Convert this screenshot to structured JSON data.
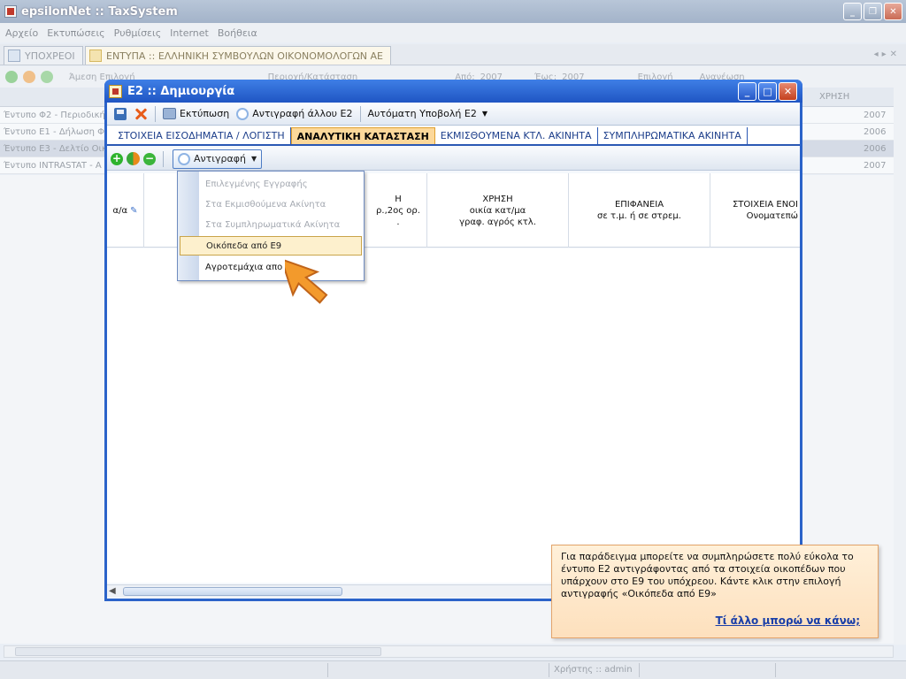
{
  "app": {
    "title": "epsilonNet :: TaxSystem",
    "window_controls": [
      "_",
      "❐",
      "✕"
    ]
  },
  "menu": [
    "Αρχείο",
    "Εκτυπώσεις",
    "Ρυθμίσεις",
    "Internet",
    "Βοήθεια"
  ],
  "doc_tabs": [
    {
      "label": "ΥΠΟΧΡΕΟΙ"
    },
    {
      "label": "ΕΝΤΥΠΑ :: ΕΛΛΗΝΙΚΗ ΣΥΜΒΟΥΛΩΝ ΟΙΚΟΝΟΜΟΛΟΓΩΝ ΑΕ"
    }
  ],
  "main_toolbar": {
    "filter": "Άμεση Επιλογή",
    "period": "Περιοχή/Κατάσταση",
    "from_label": "Από:",
    "from_year": "2007",
    "to_label": "Έως:",
    "to_year": "2007",
    "select": "Επιλογή",
    "refresh": "Ανανέωση"
  },
  "grid": {
    "col_year": "ΧΡΗΣΗ",
    "rows": [
      {
        "text": "Έντυπο Φ2 - Περιοδική",
        "year": "2007",
        "selected": false
      },
      {
        "text": "Έντυπο Ε1 - Δήλωση Φ",
        "year": "2006",
        "selected": false
      },
      {
        "text": "Έντυπο Ε3 - Δελτίο Οικ",
        "year": "2006",
        "selected": true
      },
      {
        "text": "Έντυπο INTRASTAT - Α",
        "year": "2007",
        "selected": false
      }
    ]
  },
  "status": {
    "user": "Χρήστης :: admin"
  },
  "dialog": {
    "title": "Ε2 :: Δημιουργία",
    "toolbar": {
      "print": "Εκτύπωση",
      "copy_other": "Αντιγραφή άλλου Ε2",
      "auto_submit": "Αυτόματη Υποβολή Ε2"
    },
    "tabs": [
      {
        "label": "ΣΤΟΙΧΕΙΑ ΕΙΣΟΔΗΜΑΤΙΑ / ΛΟΓΙΣΤΗ",
        "active": false
      },
      {
        "label": "ΑΝΑΛΥΤΙΚΗ ΚΑΤΑΣΤΑΣΗ",
        "active": true
      },
      {
        "label": "ΕΚΜΙΣΘΟΥΜΕΝΑ ΚΤΛ. ΑΚΙΝΗΤΑ",
        "active": false
      },
      {
        "label": "ΣΥΜΠΛΗΡΩΜΑΤΙΚΑ ΑΚΙΝΗΤΑ",
        "active": false
      }
    ],
    "sub_toolbar": {
      "copy": "Αντιγραφή"
    },
    "columns": {
      "aa": "α/α",
      "col2_l1": "Η",
      "col2_l2": "ρ.,2ος ορ.",
      "col2_l3": ".",
      "col3_l1": "ΧΡΗΣΗ",
      "col3_l2": "οικία κατ/μα",
      "col3_l3": "γραφ. αγρός κτλ.",
      "col4_l1": "ΕΠΙΦΑΝΕΙΑ",
      "col4_l2": "σε τ.μ. ή σε στρεμ.",
      "col5_l1": "ΣΤΟΙΧΕΙΑ ΕΝΟΙ",
      "col5_l2": "Ονοματεπώ"
    },
    "dropdown": [
      {
        "label": "Επιλεγμένης Εγγραφής",
        "state": "disabled"
      },
      {
        "label": "Στα Εκμισθούμενα Ακίνητα",
        "state": "disabled"
      },
      {
        "label": "Στα Συμπληρωματικά Ακίνητα",
        "state": "disabled"
      },
      {
        "label": "Οικόπεδα από Ε9",
        "state": "hover"
      },
      {
        "label": "Αγροτεμάχια απο Ε9",
        "state": "enabled"
      }
    ]
  },
  "callout": {
    "message": "Για παράδειγμα μπορείτε να συμπληρώσετε πολύ εύκολα το έντυπο Ε2 αντιγράφοντας από τα στοιχεία οικοπέδων που υπάρχουν στο Ε9 του υπόχρεου. Κάντε κλικ στην επιλογή αντιγραφής «Οικόπεδα από Ε9»",
    "link": "Τί άλλο μπορώ να κάνω;"
  },
  "colors": {
    "dialog_frame": "#2b63c9",
    "active_tab": "#fcd89a",
    "callout_bg": "#fde0bd",
    "pointer": "#f39a2c"
  }
}
